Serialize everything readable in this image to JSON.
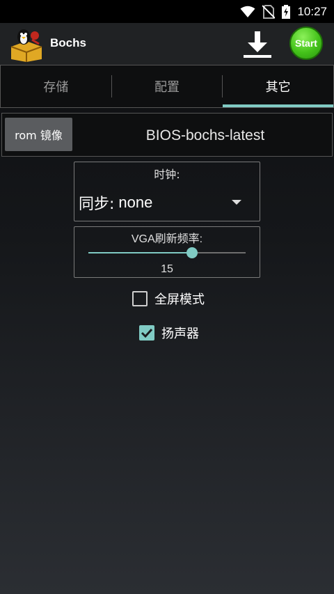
{
  "status_bar": {
    "time": "10:27",
    "icons": [
      "wifi-icon",
      "no-sim-icon",
      "battery-charging-icon"
    ]
  },
  "action_bar": {
    "app_title": "Bochs",
    "app_icon": "bochs-penguin-logo-icon",
    "download_icon": "download-icon",
    "start_label": "Start"
  },
  "tabs": [
    {
      "label": "存储",
      "active": false
    },
    {
      "label": "配置",
      "active": false
    },
    {
      "label": "其它",
      "active": true
    }
  ],
  "rom": {
    "button_label": "rom 镜像",
    "value": "BIOS-bochs-latest"
  },
  "clock": {
    "label": "时钟:",
    "prefix": "同步:",
    "selected": "none"
  },
  "vga": {
    "label": "VGA刷新频率:",
    "value": "15",
    "slider_fraction": 0.66
  },
  "options": [
    {
      "label": "全屏模式",
      "checked": false
    },
    {
      "label": "扬声器",
      "checked": true
    }
  ],
  "colors": {
    "accent": "#80cbc4",
    "start_button": "#44c21a",
    "background": "#15171a"
  }
}
